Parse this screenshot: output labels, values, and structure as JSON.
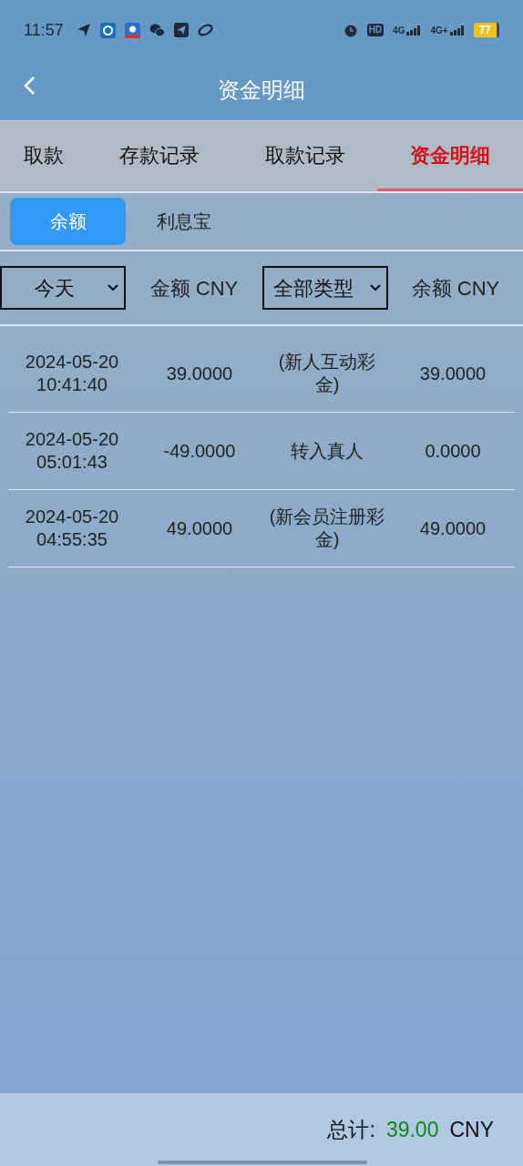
{
  "status_bar": {
    "time": "11:57",
    "hd": "HD",
    "network_1": "4G",
    "network_2": "4G+",
    "battery": "77"
  },
  "header": {
    "title": "资金明细"
  },
  "tabs": [
    {
      "label": "取款",
      "selected": false
    },
    {
      "label": "存款记录",
      "selected": false
    },
    {
      "label": "取款记录",
      "selected": false
    },
    {
      "label": "资金明细",
      "selected": true
    }
  ],
  "sub_tabs": [
    {
      "label": "余额",
      "selected": true
    },
    {
      "label": "利息宝",
      "selected": false
    }
  ],
  "filters": {
    "period": "今天",
    "amount_heading": "金额 CNY",
    "type": "全部类型",
    "balance_heading": "余额 CNY"
  },
  "rows": [
    {
      "date": "2024-05-20",
      "time": "10:41:40",
      "amount": "39.0000",
      "type": "(新人互动彩金)",
      "balance": "39.0000"
    },
    {
      "date": "2024-05-20",
      "time": "05:01:43",
      "amount": "-49.0000",
      "type": "转入真人",
      "balance": "0.0000"
    },
    {
      "date": "2024-05-20",
      "time": "04:55:35",
      "amount": "49.0000",
      "type": "(新会员注册彩金)",
      "balance": "49.0000"
    }
  ],
  "footer": {
    "label": "总计:",
    "total": "39.00",
    "currency": "CNY"
  }
}
